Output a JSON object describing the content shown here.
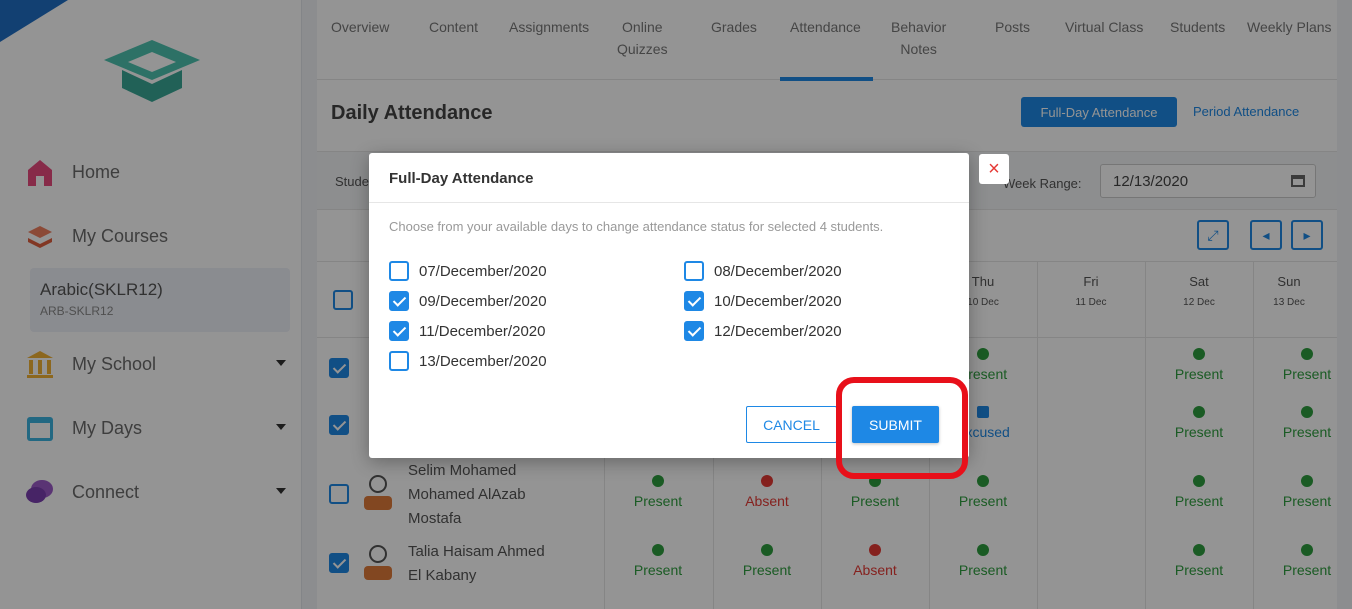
{
  "sidebar": {
    "nav": [
      {
        "label": "Home",
        "icon": "home-icon"
      },
      {
        "label": "My Courses",
        "icon": "courses-icon"
      },
      {
        "label": "My School",
        "icon": "school-icon"
      },
      {
        "label": "My Days",
        "icon": "calendar-icon"
      },
      {
        "label": "Connect",
        "icon": "chat-icon"
      }
    ],
    "course": {
      "title": "Arabic(SKLR12)",
      "code": "ARB-SKLR12"
    }
  },
  "tabs": [
    {
      "label": "Overview"
    },
    {
      "label": "Content"
    },
    {
      "label": "Assignments"
    },
    {
      "label": "Online\nQuizzes"
    },
    {
      "label": "Grades"
    },
    {
      "label": "Attendance"
    },
    {
      "label": "Behavior\nNotes"
    },
    {
      "label": "Posts"
    },
    {
      "label": "Virtual Class"
    },
    {
      "label": "Students"
    },
    {
      "label": "Weekly Plans"
    }
  ],
  "page": {
    "title": "Daily Attendance",
    "fullday_button": "Full-Day Attendance",
    "period_link": "Period Attendance",
    "students_filter": "Stude",
    "week_range_label": "Week Range:",
    "week_range_value": "12/13/2020"
  },
  "grid": {
    "days": [
      {
        "name": "Thu",
        "date": "10 Dec"
      },
      {
        "name": "Fri",
        "date": "11 Dec"
      },
      {
        "name": "Sat",
        "date": "12 Dec"
      },
      {
        "name": "Sun",
        "date": "13 Dec"
      }
    ],
    "students": [
      {
        "name_lines": [
          "Selim Mohamed",
          "Mohamed AlAzab",
          "Mostafa"
        ]
      },
      {
        "name_lines": [
          "Talia Haisam Ahmed",
          "El Kabany"
        ]
      }
    ],
    "status_labels": {
      "present": "Present",
      "absent": "Absent",
      "excused": "Excused"
    }
  },
  "modal": {
    "title": "Full-Day Attendance",
    "description": "Choose from your available days to change attendance status for selected 4 students.",
    "options": [
      {
        "label": "07/December/2020",
        "checked": false
      },
      {
        "label": "08/December/2020",
        "checked": false
      },
      {
        "label": "09/December/2020",
        "checked": true
      },
      {
        "label": "10/December/2020",
        "checked": true
      },
      {
        "label": "11/December/2020",
        "checked": true
      },
      {
        "label": "12/December/2020",
        "checked": true
      },
      {
        "label": "13/December/2020",
        "checked": false
      }
    ],
    "cancel_label": "CANCEL",
    "submit_label": "SUBMIT",
    "close_glyph": "×"
  },
  "colors": {
    "accent": "#1e88e5",
    "highlight": "#e8101a",
    "present": "#2e9e3e",
    "absent": "#e53935"
  }
}
